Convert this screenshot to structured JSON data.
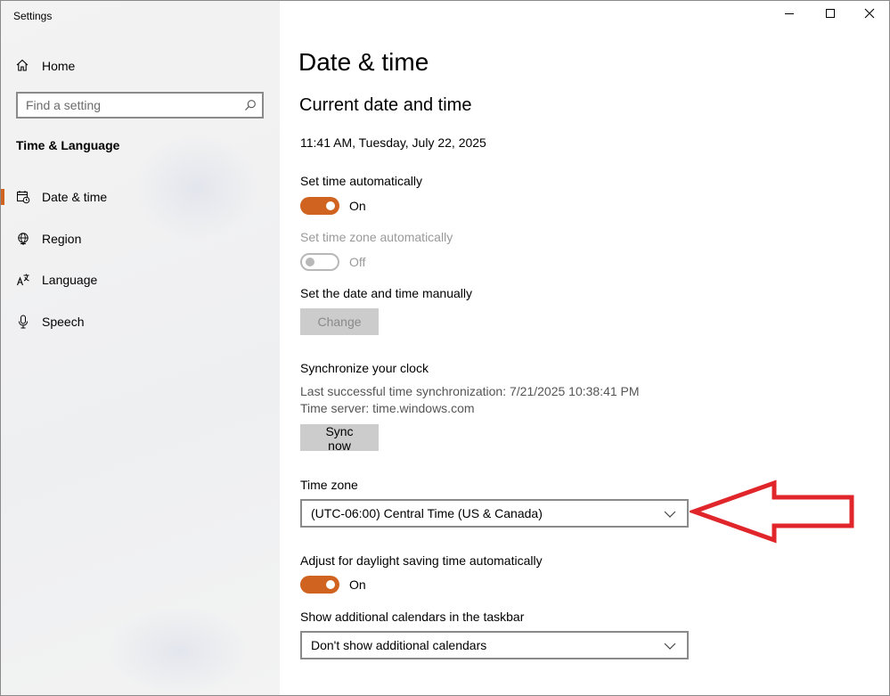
{
  "window": {
    "title": "Settings"
  },
  "sidebar": {
    "home_label": "Home",
    "search_placeholder": "Find a setting",
    "section_label": "Time & Language",
    "items": [
      {
        "label": "Date & time",
        "icon": "calendar-clock-icon",
        "active": true
      },
      {
        "label": "Region",
        "icon": "globe-icon",
        "active": false
      },
      {
        "label": "Language",
        "icon": "language-icon",
        "active": false
      },
      {
        "label": "Speech",
        "icon": "microphone-icon",
        "active": false
      }
    ]
  },
  "main": {
    "title": "Date & time",
    "subtitle": "Current date and time",
    "current_datetime": "11:41 AM, Tuesday, July 22, 2025",
    "set_time_auto": {
      "label": "Set time automatically",
      "state_label": "On",
      "on": true
    },
    "set_timezone_auto": {
      "label": "Set time zone automatically",
      "state_label": "Off",
      "on": false,
      "disabled": true
    },
    "manual": {
      "label": "Set the date and time manually",
      "button": "Change"
    },
    "sync": {
      "label": "Synchronize your clock",
      "last_sync": "Last successful time synchronization: 7/21/2025 10:38:41 PM",
      "server": "Time server: time.windows.com",
      "button": "Sync now"
    },
    "time_zone": {
      "label": "Time zone",
      "value": "(UTC-06:00) Central Time (US & Canada)"
    },
    "dst": {
      "label": "Adjust for daylight saving time automatically",
      "state_label": "On",
      "on": true
    },
    "calendars": {
      "label": "Show additional calendars in the taskbar",
      "value": "Don't show additional calendars"
    }
  },
  "colors": {
    "accent": "#d0631f",
    "annotation": "#e0262a",
    "sidebar_bg": "#f2f2f2"
  }
}
